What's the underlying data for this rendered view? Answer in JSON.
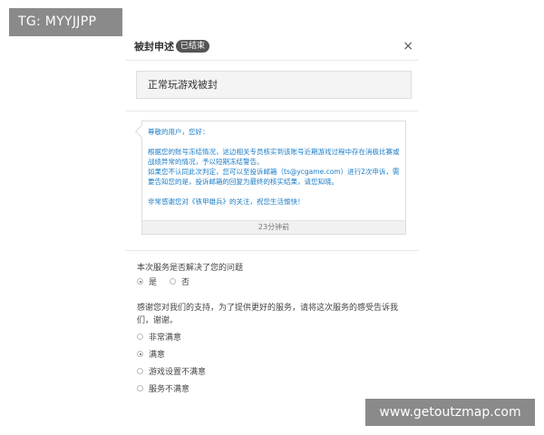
{
  "watermarks": {
    "top_left": "TG: MYYJJPP",
    "bottom_right": "www.getoutzmap.com"
  },
  "dialog": {
    "title": "被封申述",
    "status_badge": "已结束",
    "close_icon": "×",
    "reason": "正常玩游戏被封",
    "message": {
      "greeting": "尊敬的用户，您好：",
      "line1": "根据您的账号冻结情况，这边相关专员核实到该账号近期游戏过程中存在消极比赛或战绩异常的情况，予以短期冻结警告。",
      "line2": "如果您不认同此次判定，您可以至投诉邮箱（ts@ycgame.com）进行2次申诉，需要告知您的是，投诉邮箱的回复为最终的核实结果，请您知晓。",
      "line3": "非常感谢您对《铁甲雄兵》的关注，祝您生活愉快！",
      "time": "23分钟前"
    },
    "question1": {
      "label": "本次服务是否解决了您的问题",
      "options": [
        {
          "label": "是",
          "selected": true
        },
        {
          "label": "否",
          "selected": false
        }
      ]
    },
    "question2": {
      "label": "感谢您对我们的支持，为了提供更好的服务，请将这次服务的感受告诉我们，谢谢。",
      "options": [
        {
          "label": "非常满意",
          "selected": false
        },
        {
          "label": "满意",
          "selected": true
        },
        {
          "label": "游戏设置不满意",
          "selected": false
        },
        {
          "label": "服务不满意",
          "selected": false
        }
      ]
    }
  }
}
